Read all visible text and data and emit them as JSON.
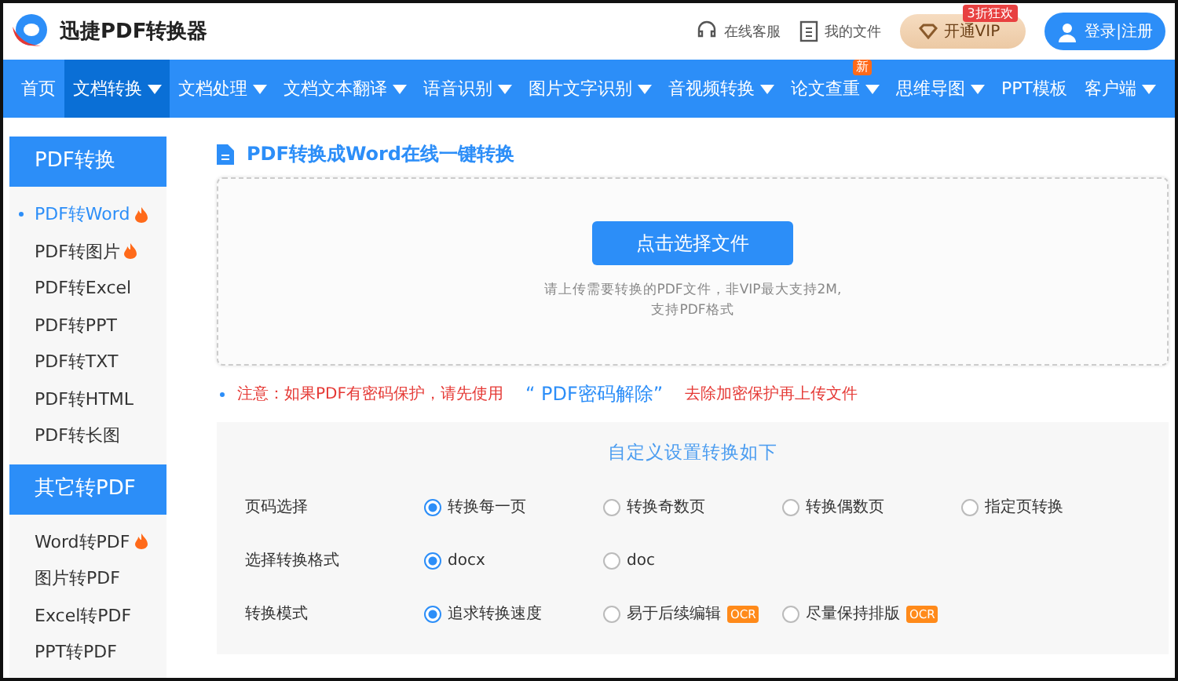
{
  "header": {
    "logo_text": "迅捷PDF转换器",
    "links": [
      {
        "kind": "service",
        "label": "在线客服"
      },
      {
        "kind": "files",
        "label": "我的文件"
      }
    ],
    "vip": {
      "label": "开通VIP",
      "badge": "3折狂欢"
    },
    "login": {
      "label": "登录|注册"
    }
  },
  "nav": [
    {
      "label": "首页",
      "dropdown": false,
      "selected": false
    },
    {
      "label": "文档转换",
      "dropdown": true,
      "selected": true
    },
    {
      "label": "文档处理",
      "dropdown": true,
      "selected": false
    },
    {
      "label": "文档文本翻译",
      "dropdown": true,
      "selected": false
    },
    {
      "label": "语音识别",
      "dropdown": true,
      "selected": false
    },
    {
      "label": "图片文字识别",
      "dropdown": true,
      "selected": false
    },
    {
      "label": "音视频转换",
      "dropdown": true,
      "selected": false
    },
    {
      "label": "论文查重",
      "dropdown": true,
      "selected": false,
      "badge": "新"
    },
    {
      "label": "思维导图",
      "dropdown": true,
      "selected": false
    },
    {
      "label": "PPT模板",
      "dropdown": false,
      "selected": false
    },
    {
      "label": "客户端",
      "dropdown": true,
      "selected": false
    }
  ],
  "sidebar": [
    {
      "title": "PDF转换",
      "items": [
        {
          "label": "PDF转Word",
          "hot": true,
          "selected": true
        },
        {
          "label": "PDF转图片",
          "hot": true,
          "selected": false
        },
        {
          "label": "PDF转Excel",
          "hot": false,
          "selected": false
        },
        {
          "label": "PDF转PPT",
          "hot": false,
          "selected": false
        },
        {
          "label": "PDF转TXT",
          "hot": false,
          "selected": false
        },
        {
          "label": "PDF转HTML",
          "hot": false,
          "selected": false
        },
        {
          "label": "PDF转长图",
          "hot": false,
          "selected": false
        }
      ]
    },
    {
      "title": "其它转PDF",
      "items": [
        {
          "label": "Word转PDF",
          "hot": true,
          "selected": false
        },
        {
          "label": "图片转PDF",
          "hot": false,
          "selected": false
        },
        {
          "label": "Excel转PDF",
          "hot": false,
          "selected": false
        },
        {
          "label": "PPT转PDF",
          "hot": false,
          "selected": false
        }
      ]
    }
  ],
  "main": {
    "title": "PDF转换成Word在线一键转换",
    "upload": {
      "button": "点击选择文件",
      "hint": "请上传需要转换的PDF文件，非VIP最大支持2M,\n支持PDF格式"
    },
    "notice": {
      "before": "注意：如果PDF有密码保护，请先使用",
      "link": "“ PDF密码解除”",
      "after": "去除加密保护再上传文件"
    },
    "settings": {
      "title": "自定义设置转换如下",
      "rows": [
        {
          "label": "页码选择",
          "options": [
            {
              "label": "转换每一页",
              "selected": true
            },
            {
              "label": "转换奇数页",
              "selected": false
            },
            {
              "label": "转换偶数页",
              "selected": false
            },
            {
              "label": "指定页转换",
              "selected": false
            }
          ]
        },
        {
          "label": "选择转换格式",
          "options": [
            {
              "label": "docx",
              "selected": true
            },
            {
              "label": "doc",
              "selected": false
            }
          ]
        },
        {
          "label": "转换模式",
          "options": [
            {
              "label": "追求转换速度",
              "selected": true
            },
            {
              "label": "易于后续编辑",
              "selected": false,
              "badge": "OCR"
            },
            {
              "label": "尽量保持排版",
              "selected": false,
              "badge": "OCR"
            }
          ]
        }
      ]
    }
  }
}
